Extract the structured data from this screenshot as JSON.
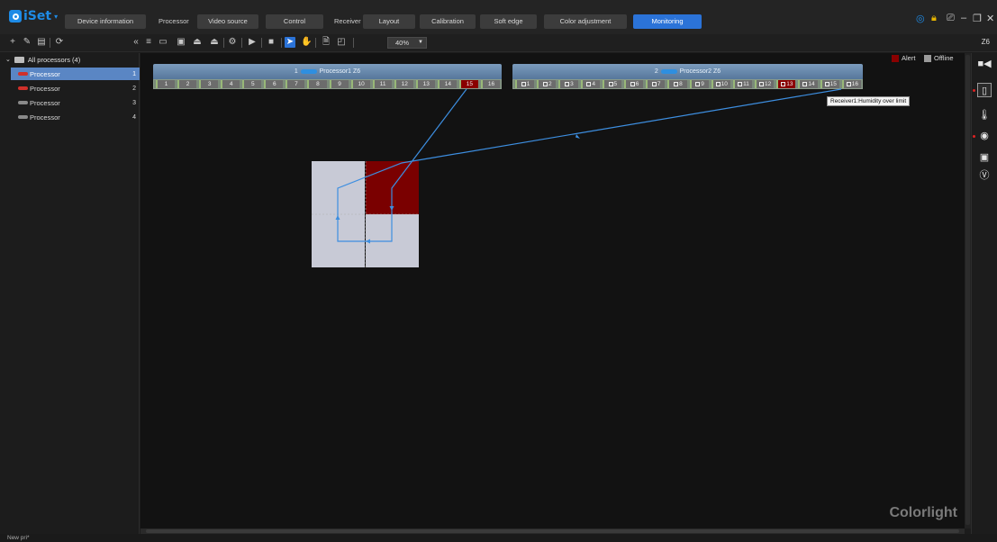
{
  "app": {
    "name": "iSet"
  },
  "menu": {
    "device_information": "Device information",
    "processor_label": "Processor",
    "video_source": "Video source",
    "control": "Control",
    "receiver_label": "Receiver",
    "layout": "Layout",
    "calibration": "Calibration",
    "soft_edge": "Soft edge",
    "color_adjustment": "Color adjustment",
    "monitoring": "Monitoring"
  },
  "toolbar": {
    "zoom": "40%",
    "section_label": "Z6"
  },
  "sidebar": {
    "root_label": "All processors (4)",
    "items": [
      {
        "label": "Processor",
        "num": "1",
        "selected": true,
        "chip": "#d0302a"
      },
      {
        "label": "Processor",
        "num": "2",
        "selected": false,
        "chip": "#d0302a"
      },
      {
        "label": "Processor",
        "num": "3",
        "selected": false,
        "chip": "#8a8a8a"
      },
      {
        "label": "Processor",
        "num": "4",
        "selected": false,
        "chip": "#8a8a8a"
      }
    ]
  },
  "legend": {
    "alert": "Alert",
    "offline": "Offline",
    "alert_color": "#8a0000",
    "offline_color": "#9a9a9a"
  },
  "processors": [
    {
      "index": "1",
      "name": "Processor1 Z6",
      "ports": [
        "1",
        "2",
        "3",
        "4",
        "5",
        "6",
        "7",
        "8",
        "9",
        "10",
        "11",
        "12",
        "13",
        "14",
        "15",
        "16"
      ],
      "alert_port": "15"
    },
    {
      "index": "2",
      "name": "Processor2 Z6",
      "ports": [
        "1",
        "2",
        "3",
        "4",
        "5",
        "6",
        "7",
        "8",
        "9",
        "10",
        "11",
        "12",
        "13",
        "14",
        "15",
        "16"
      ],
      "alert_port": "13"
    }
  ],
  "tooltip": "Receiver1:Humidity over limit",
  "watermark": "Colorlight",
  "status": {
    "text": "New pri*"
  },
  "colors": {
    "accent": "#2b73d8",
    "alert": "#8a0000",
    "line": "#3d8ee0"
  }
}
